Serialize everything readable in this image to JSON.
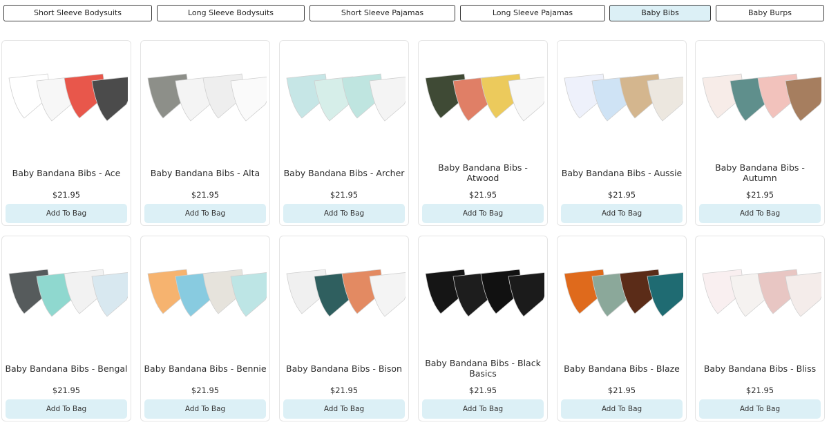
{
  "tabs": [
    {
      "label": "Short Sleeve Bodysuits",
      "active": false
    },
    {
      "label": "Long Sleeve Bodysuits",
      "active": false
    },
    {
      "label": "Short Sleeve Pajamas",
      "active": false
    },
    {
      "label": "Long Sleeve Pajamas",
      "active": false
    },
    {
      "label": "Baby Bibs",
      "active": true
    },
    {
      "label": "Baby Burps",
      "active": false
    }
  ],
  "products": [
    {
      "name": "Baby Bandana Bibs - Ace",
      "price": "$21.95",
      "button": "Add To Bag",
      "swatches": [
        "#ffffff",
        "#f7f7f7",
        "#e8574b",
        "#4b4b4b"
      ]
    },
    {
      "name": "Baby Bandana Bibs - Alta",
      "price": "$21.95",
      "button": "Add To Bag",
      "swatches": [
        "#8d8f89",
        "#f4f4f4",
        "#eeeeee",
        "#fafafa"
      ]
    },
    {
      "name": "Baby Bandana Bibs - Archer",
      "price": "$21.95",
      "button": "Add To Bag",
      "swatches": [
        "#c6e6e6",
        "#d6eee9",
        "#bfe5e0",
        "#f4f4f4"
      ]
    },
    {
      "name": "Baby Bandana Bibs - Atwood",
      "price": "$21.95",
      "button": "Add To Bag",
      "swatches": [
        "#3f4a35",
        "#e07f66",
        "#ecca5c",
        "#f7f7f7"
      ]
    },
    {
      "name": "Baby Bandana Bibs - Aussie",
      "price": "$21.95",
      "button": "Add To Bag",
      "swatches": [
        "#eef1fb",
        "#cfe3f5",
        "#d4b68e",
        "#ece7df"
      ]
    },
    {
      "name": "Baby Bandana Bibs - Autumn",
      "price": "$21.95",
      "button": "Add To Bag",
      "swatches": [
        "#f7ece8",
        "#5f8f8c",
        "#f2c2bc",
        "#a67e5f"
      ]
    },
    {
      "name": "Baby Bandana Bibs - Bengal",
      "price": "$21.95",
      "button": "Add To Bag",
      "swatches": [
        "#565b5c",
        "#8fd8cf",
        "#f2f2f2",
        "#d8e8f0"
      ]
    },
    {
      "name": "Baby Bandana Bibs - Bennie",
      "price": "$21.95",
      "button": "Add To Bag",
      "swatches": [
        "#f6b36f",
        "#88cbe0",
        "#e6e3dc",
        "#bde5e5"
      ]
    },
    {
      "name": "Baby Bandana Bibs - Bison",
      "price": "$21.95",
      "button": "Add To Bag",
      "swatches": [
        "#f0f0f0",
        "#2f5f5f",
        "#e38a62",
        "#f4f4f4"
      ]
    },
    {
      "name": "Baby Bandana Bibs - Black Basics",
      "price": "$21.95",
      "button": "Add To Bag",
      "swatches": [
        "#151515",
        "#1d1d1d",
        "#111111",
        "#1b1b1b"
      ]
    },
    {
      "name": "Baby Bandana Bibs - Blaze",
      "price": "$21.95",
      "button": "Add To Bag",
      "swatches": [
        "#df6a1c",
        "#8ba89a",
        "#5b2c18",
        "#1f6b72"
      ]
    },
    {
      "name": "Baby Bandana Bibs - Bliss",
      "price": "$21.95",
      "button": "Add To Bag",
      "swatches": [
        "#f9eff0",
        "#f5f2f0",
        "#e8c6c3",
        "#f4ecea"
      ]
    }
  ]
}
